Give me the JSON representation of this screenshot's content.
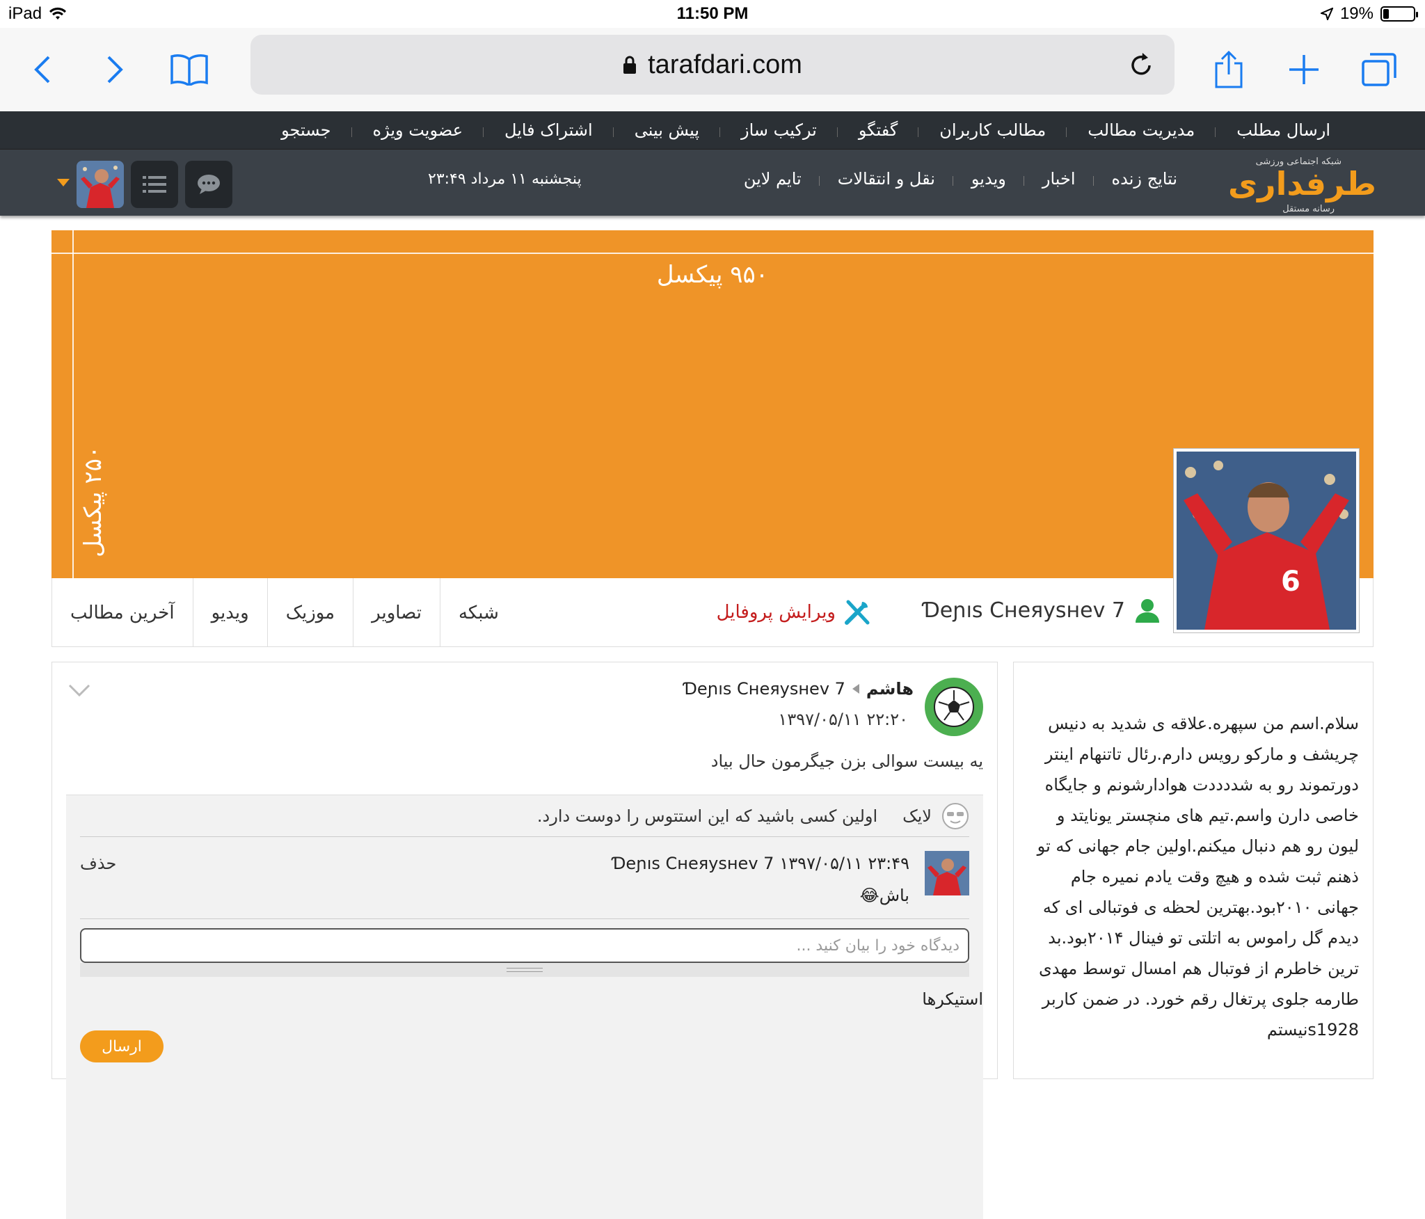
{
  "statusbar": {
    "device": "iPad",
    "time": "11:50 PM",
    "battery": "19%",
    "battery_level": 0.19
  },
  "browser": {
    "url": "tarafdari.com",
    "icons": [
      "back-icon",
      "forward-icon",
      "bookmarks-icon",
      "lock-icon",
      "reload-icon",
      "share-icon",
      "new-tab-icon",
      "tabs-icon"
    ]
  },
  "nav_top": {
    "items": [
      "ارسال مطلب",
      "مدیریت مطالب",
      "مطالب کاربران",
      "گفتگو",
      "ترکیب ساز",
      "پیش بینی",
      "اشتراک فایل",
      "عضویت ویژه",
      "جستجو"
    ]
  },
  "nav_main": {
    "logo_tag": "شبکه اجتماعی ورزشی",
    "logo_text": "طرفداری",
    "logo_sub": "رسانه مستقل",
    "links": [
      "نتایج زنده",
      "اخبار",
      "ویدیو",
      "نقل و انتقالات",
      "تایم لاین"
    ],
    "date": "پنجشنبه ۱۱ مرداد ۲۳:۴۹"
  },
  "cover": {
    "width_label": "۹۵۰ پیکسل",
    "height_label": "۲۵۰ پیکسل",
    "color": "#ef9428"
  },
  "profile": {
    "name": "Ɗeɲıs Cнeяysнev 7",
    "edit_label": "ویرایش پروفایل",
    "tabs": [
      "شبکه",
      "تصاویر",
      "موزیک",
      "ویدیو",
      "آخرین مطالب"
    ]
  },
  "post": {
    "author": "هاشم",
    "target": "Ɗeɲıs Cнeяysнev 7",
    "time": "۱۳۹۷/۰۵/۱۱ ۲۲:۲۰",
    "text": "یه بیست سوالی بزن جیگرمون حال بیاد",
    "like_label": "لایک",
    "like_prompt": "اولین کسی باشید که این استتوس را دوست دارد.",
    "comment": {
      "author": "Ɗeɲıs Cнeяysнev 7",
      "time": "۱۳۹۷/۰۵/۱۱ ۲۳:۴۹",
      "text": "باش😂",
      "delete_label": "حذف"
    },
    "comment_placeholder": "دیدگاه خود را بیان کنید ...",
    "stickers_label": "استیکرها",
    "send_label": "ارسال"
  },
  "bio": {
    "text": "سلام.اسم من سپهره.علاقه ی شدید به دنیس چریشف و مارکو رویس دارم.رئال تاتنهام اینتر دورتموند رو به شددددت هوادارشونم و جایگاه خاصی دارن واسم.تیم های منچستر یونایتد و لیون رو هم دنبال میکنم.اولین جام جهانی که تو ذهنم ثبت شده و هیچ وقت یادم نمیره جام جهانی ۲۰۱۰بود.بهترین لحظه ی فوتبالی ای که دیدم گل راموس به اتلتی تو فینال ۲۰۱۴بود.بد ترین خاطرم از فوتبال هم امسال توسط مهدی طارمه جلوی پرتغال رقم خورد. در ضمن کاربر s1928نیستم"
  },
  "colors": {
    "accent": "#f39c1c",
    "nav_dark": "#3b4148",
    "ios_blue": "#1a7cf0"
  }
}
